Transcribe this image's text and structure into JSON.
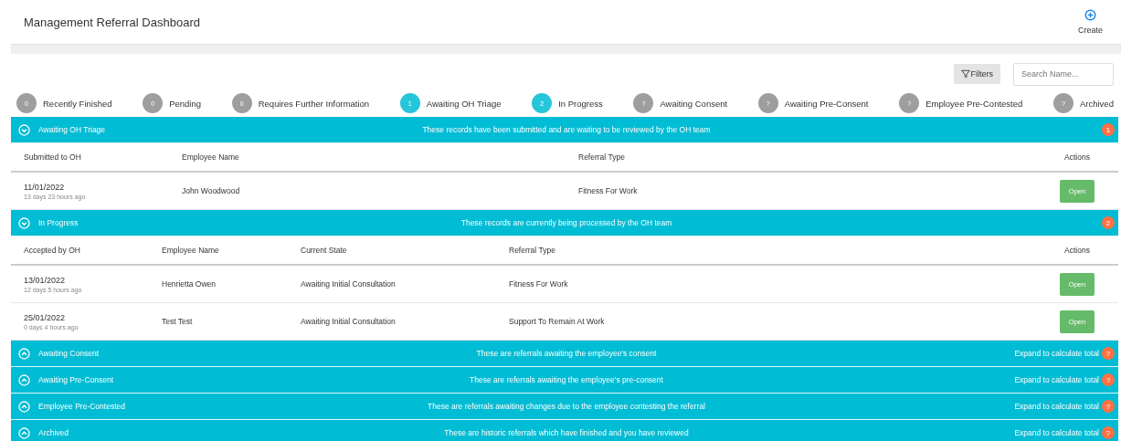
{
  "page": {
    "title": "Management Referral Dashboard",
    "create_label": "Create"
  },
  "toolbar": {
    "filters_label": "Filters",
    "search_placeholder": "Search Name..."
  },
  "statuses": [
    {
      "count": "0",
      "label": "Recently Finished",
      "color": "#9e9e9e"
    },
    {
      "count": "0",
      "label": "Pending",
      "color": "#9e9e9e"
    },
    {
      "count": "0",
      "label": "Requires Further Information",
      "color": "#9e9e9e"
    },
    {
      "count": "1",
      "label": "Awaiting OH Triage",
      "color": "#26c6da"
    },
    {
      "count": "2",
      "label": "In Progress",
      "color": "#26c6da"
    },
    {
      "count": "?",
      "label": "Awaiting Consent",
      "color": "#9e9e9e"
    },
    {
      "count": "?",
      "label": "Awaiting Pre-Consent",
      "color": "#9e9e9e"
    },
    {
      "count": "?",
      "label": "Employee Pre-Contested",
      "color": "#9e9e9e"
    },
    {
      "count": "?",
      "label": "Archived",
      "color": "#9e9e9e"
    }
  ],
  "sections": [
    {
      "title": "Awaiting OH Triage",
      "description": "These records have been submitted and are waiting to be reviewed by the OH team",
      "badge": "1",
      "expanded": true,
      "columns": [
        "Submitted to OH",
        "Employee Name",
        "Referral Type",
        "Actions"
      ],
      "rows": [
        {
          "cells": [
            "11/01/2022",
            "John Woodwood",
            "Fitness For Work",
            "Open"
          ],
          "ago": "13 days 23 hours ago"
        }
      ]
    },
    {
      "title": "In Progress",
      "description": "These records are currently being processed by the OH team",
      "badge": "2",
      "expanded": true,
      "columns": [
        "Accepted by OH",
        "Employee Name",
        "Current State",
        "Referral Type",
        "Actions"
      ],
      "rows": [
        {
          "cells": [
            "13/01/2022",
            "Henrietta Owen",
            "Awaiting Initial Consultation",
            "Fitness For Work",
            "Open"
          ],
          "ago": "12 days 5 hours ago"
        },
        {
          "cells": [
            "25/01/2022",
            "Test Test",
            "Awaiting Initial Consultation",
            "Support To Remain At Work",
            "Open"
          ],
          "ago": "0 days 4 hours ago"
        }
      ]
    },
    {
      "title": "Awaiting Consent",
      "description": "These are referrals awaiting the employee's consent",
      "total_label": "Expand to calculate total",
      "badge": "?",
      "expanded": false
    },
    {
      "title": "Awaiting Pre-Consent",
      "description": "These are referrals awaiting the employee's pre-consent",
      "total_label": "Expand to calculate total",
      "badge": "?",
      "expanded": false
    },
    {
      "title": "Employee Pre-Contested",
      "description": "These are referrals awaiting changes due to the employee contesting the referral",
      "total_label": "Expand to calculate total",
      "badge": "?",
      "expanded": false
    },
    {
      "title": "Archived",
      "description": "These are historic referrals which have finished and you have reviewed",
      "total_label": "Expand to calculate total",
      "badge": "?",
      "expanded": false
    }
  ]
}
